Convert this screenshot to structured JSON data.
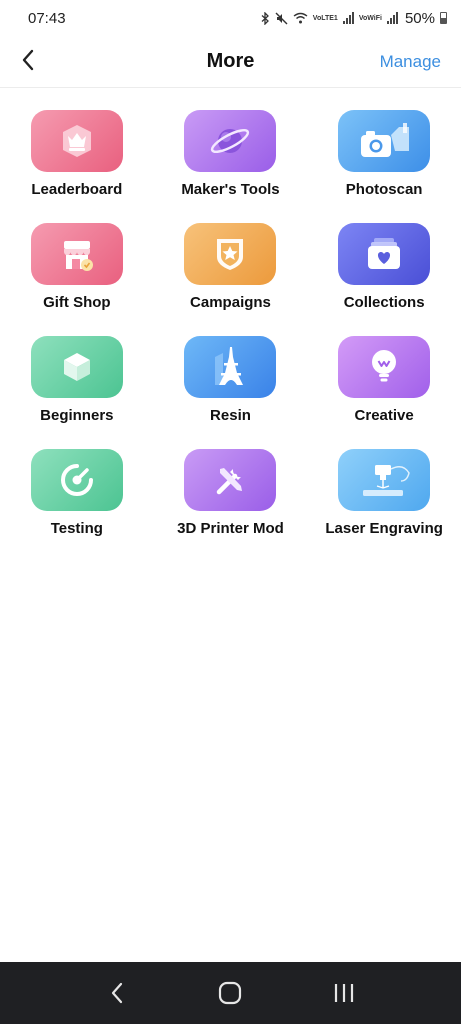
{
  "status_bar": {
    "time": "07:43",
    "battery": "50%",
    "icons": [
      "bluetooth-icon",
      "mute-icon",
      "wifi-icon",
      "volte-lte-icon",
      "signal-icon",
      "vowifi-icon",
      "signal-icon",
      "battery-icon"
    ],
    "volte_label": "VoLTE1",
    "vowifi_label": "VoWiFi"
  },
  "header": {
    "title": "More",
    "manage_label": "Manage",
    "back_icon": "chevron-left-icon"
  },
  "grid": {
    "tiles": [
      {
        "label": "Leaderboard",
        "icon": "crown-icon",
        "color_from": "#f59bb0",
        "color_to": "#e9607f"
      },
      {
        "label": "Maker's Tools",
        "icon": "planet-icon",
        "color_from": "#c99bf5",
        "color_to": "#9a5ee8"
      },
      {
        "label": "Photoscan",
        "icon": "camera-icon",
        "color_from": "#7cc2f8",
        "color_to": "#3d8fe8"
      },
      {
        "label": "Gift Shop",
        "icon": "shop-icon",
        "color_from": "#f59bb0",
        "color_to": "#e9607f"
      },
      {
        "label": "Campaigns",
        "icon": "badge-star-icon",
        "color_from": "#f7c27a",
        "color_to": "#ec9a3c"
      },
      {
        "label": "Collections",
        "icon": "heart-box-icon",
        "color_from": "#7d85f4",
        "color_to": "#4a4fd6"
      },
      {
        "label": "Beginners",
        "icon": "cube-icon",
        "color_from": "#8ee0bd",
        "color_to": "#4cc492"
      },
      {
        "label": "Resin",
        "icon": "eiffel-tower-icon",
        "color_from": "#6eb8f7",
        "color_to": "#3a82e8"
      },
      {
        "label": "Creative",
        "icon": "lightbulb-icon",
        "color_from": "#d39bf7",
        "color_to": "#a160ea"
      },
      {
        "label": "Testing",
        "icon": "gauge-icon",
        "color_from": "#8ee0bd",
        "color_to": "#4cc492"
      },
      {
        "label": "3D Printer Mod",
        "icon": "tools-icon",
        "color_from": "#c99bf5",
        "color_to": "#9a5ee8"
      },
      {
        "label": "Laser Engraving",
        "icon": "laser-icon",
        "color_from": "#8fd0fa",
        "color_to": "#4fa8ef"
      }
    ]
  },
  "nav_bar": {
    "buttons": [
      "back-nav-icon",
      "home-nav-icon",
      "recents-nav-icon"
    ]
  }
}
